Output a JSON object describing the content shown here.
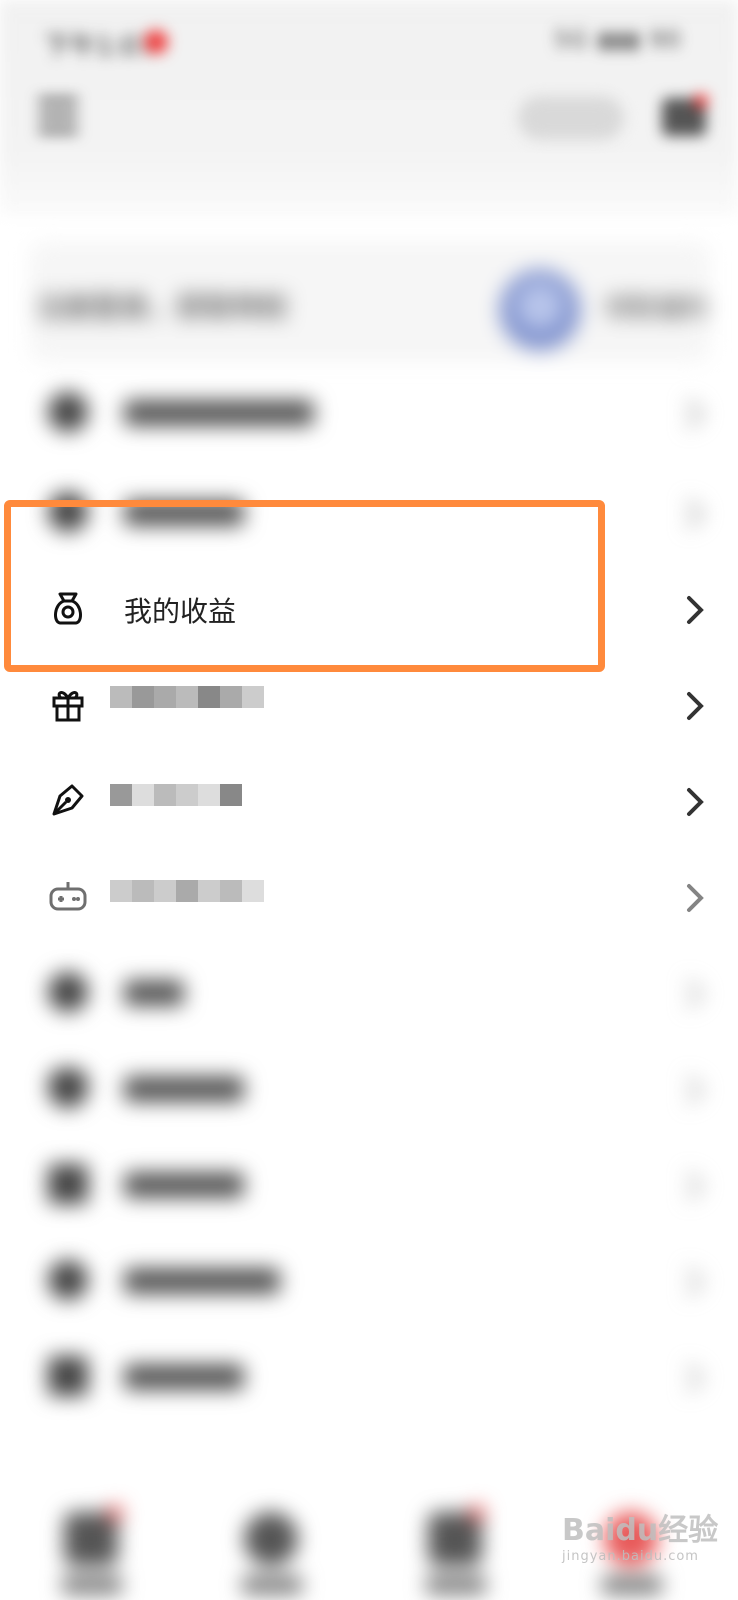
{
  "status_bar": {
    "time": "下午1:07",
    "right_status": "5G  ▮▮▮  90"
  },
  "header": {
    "signin_label": "签到"
  },
  "profile": {
    "prompt": "注册登录，获取特权",
    "right_label": "领取福利"
  },
  "menu": [
    {
      "label": "",
      "icon": "blurred-icon",
      "blurred": true
    },
    {
      "label": "",
      "icon": "blurred-icon",
      "blurred": true
    },
    {
      "label": "我的收益",
      "icon": "money-bag-icon",
      "blurred": false,
      "highlighted": true
    },
    {
      "label": "",
      "icon": "gift-icon",
      "blurred": false,
      "pixelated": true
    },
    {
      "label": "",
      "icon": "pen-nib-icon",
      "blurred": false,
      "pixelated": true
    },
    {
      "label": "",
      "icon": "gamepad-icon",
      "blurred": false,
      "pixelated": true
    },
    {
      "label": "",
      "icon": "blurred-icon",
      "blurred": true
    },
    {
      "label": "",
      "icon": "blurred-icon",
      "blurred": true
    },
    {
      "label": "",
      "icon": "blurred-icon",
      "blurred": true
    },
    {
      "label": "",
      "icon": "blurred-icon",
      "blurred": true
    },
    {
      "label": "",
      "icon": "blurred-icon",
      "blurred": true
    }
  ],
  "colors": {
    "highlight": "#ff8a3c",
    "badge": "#ee4040",
    "text": "#222222"
  },
  "watermark": {
    "brand": "Baidu经验",
    "url": "jingyan.baidu.com"
  }
}
